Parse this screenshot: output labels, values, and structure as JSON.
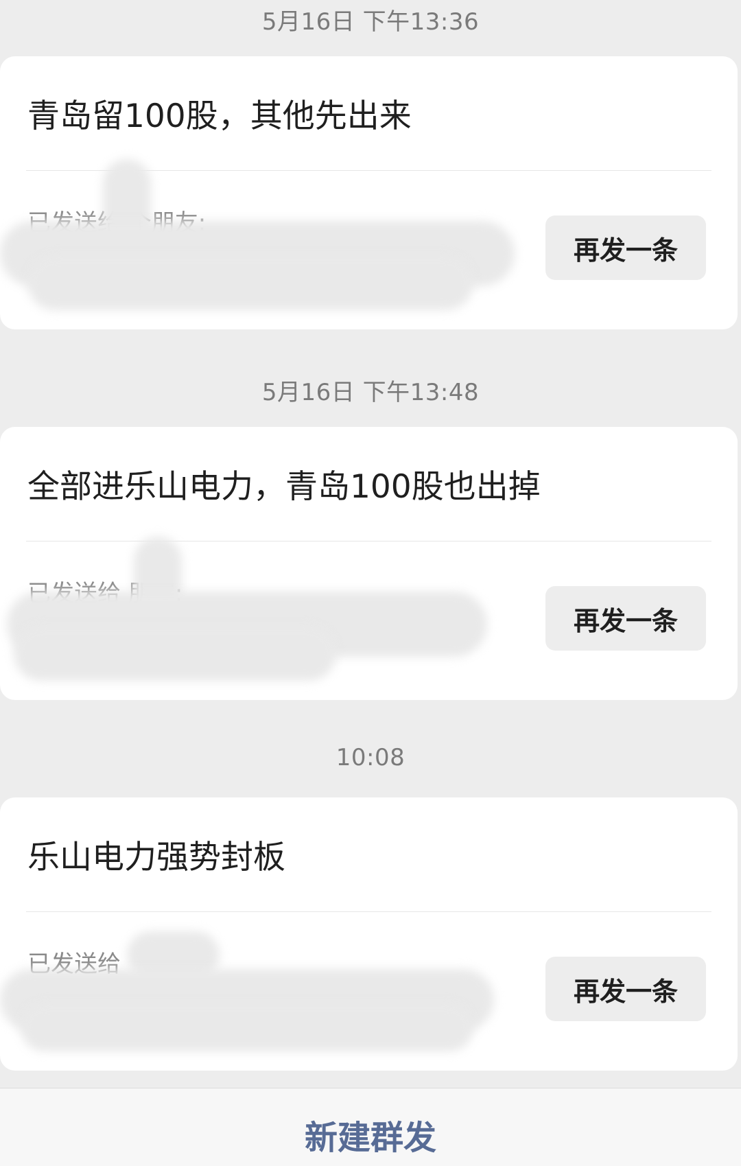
{
  "broadcasts": [
    {
      "timestamp": "5月16日 下午13:36",
      "message": "青岛留100股，其他先出来",
      "recipients_label": "已发送给  个朋友:",
      "resend_label": "再发一条"
    },
    {
      "timestamp": "5月16日 下午13:48",
      "message": "全部进乐山电力，青岛100股也出掉",
      "recipients_label": "已发送给  朋友:",
      "resend_label": "再发一条"
    },
    {
      "timestamp": "10:08",
      "message": "乐山电力强势封板",
      "recipients_label": "已发送给",
      "resend_label": "再发一条"
    }
  ],
  "footer": {
    "new_broadcast_label": "新建群发"
  }
}
